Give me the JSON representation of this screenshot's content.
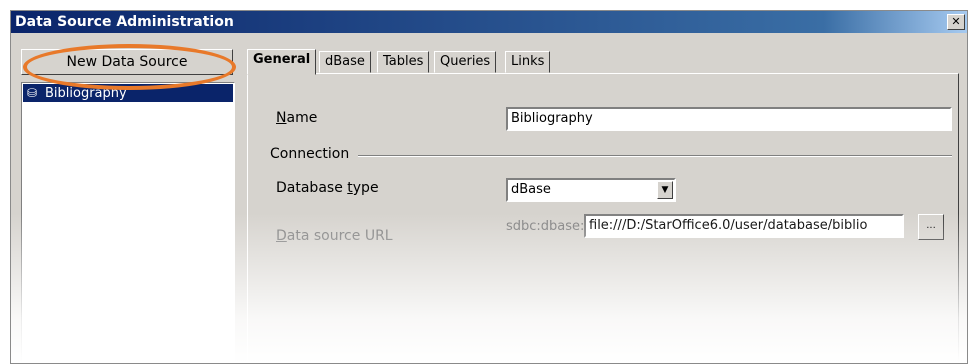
{
  "window": {
    "title": "Data Source Administration",
    "close_glyph": "✕"
  },
  "left_panel": {
    "new_button_label": "New Data Source",
    "data_sources": [
      {
        "label": "Bibliography",
        "icon": "database-icon",
        "selected": true
      }
    ]
  },
  "tabs": [
    {
      "label": "General",
      "active": true
    },
    {
      "label": "dBase",
      "active": false
    },
    {
      "label": "Tables",
      "active": false
    },
    {
      "label": "Queries",
      "active": false
    },
    {
      "label": "Links",
      "active": false
    }
  ],
  "general": {
    "name_label_u": "N",
    "name_label_rest": "ame",
    "name_value": "Bibliography",
    "connection_group": "Connection",
    "db_type_label_pre": "Database ",
    "db_type_label_u": "t",
    "db_type_label_rest": "ype",
    "db_type_value": "dBase",
    "url_label_u": "D",
    "url_label_rest": "ata source URL",
    "url_prefix": "sdbc:dbase:",
    "url_value": "file:///D:/StarOffice6.0/user/database/biblio",
    "browse_label": "..."
  },
  "colors": {
    "dialog_bg": "#d6d3ce",
    "title_bg": "#0a246a",
    "highlight": "#e8792a"
  }
}
